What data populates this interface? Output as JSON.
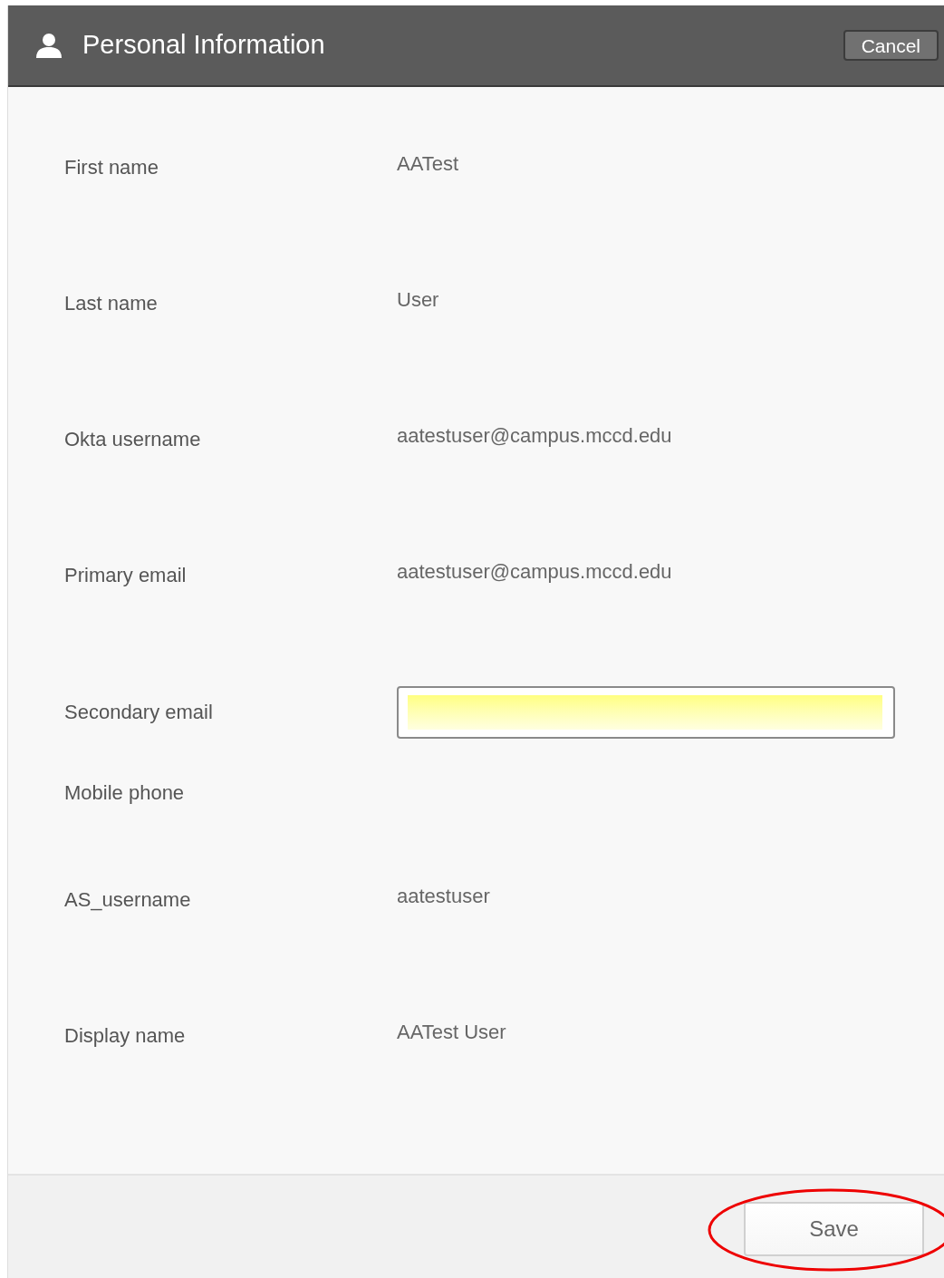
{
  "header": {
    "title": "Personal Information",
    "cancel_button": "Cancel"
  },
  "fields": [
    {
      "kind": "text",
      "label": "First name",
      "value": "AATest"
    },
    {
      "kind": "text",
      "label": "Last name",
      "value": "User"
    },
    {
      "kind": "text",
      "label": "Okta username",
      "value": "aatestuser@campus.mccd.edu"
    },
    {
      "kind": "text",
      "label": "Primary email",
      "value": "aatestuser@campus.mccd.edu"
    },
    {
      "kind": "input",
      "label": "Secondary email",
      "autofilled": true
    },
    {
      "kind": "empty",
      "label": "Mobile phone"
    },
    {
      "kind": "text",
      "label": "AS_username",
      "value": "aatestuser"
    },
    {
      "kind": "text",
      "label": "Display name",
      "value": "AATest User"
    }
  ],
  "footer": {
    "save_button": "Save"
  }
}
